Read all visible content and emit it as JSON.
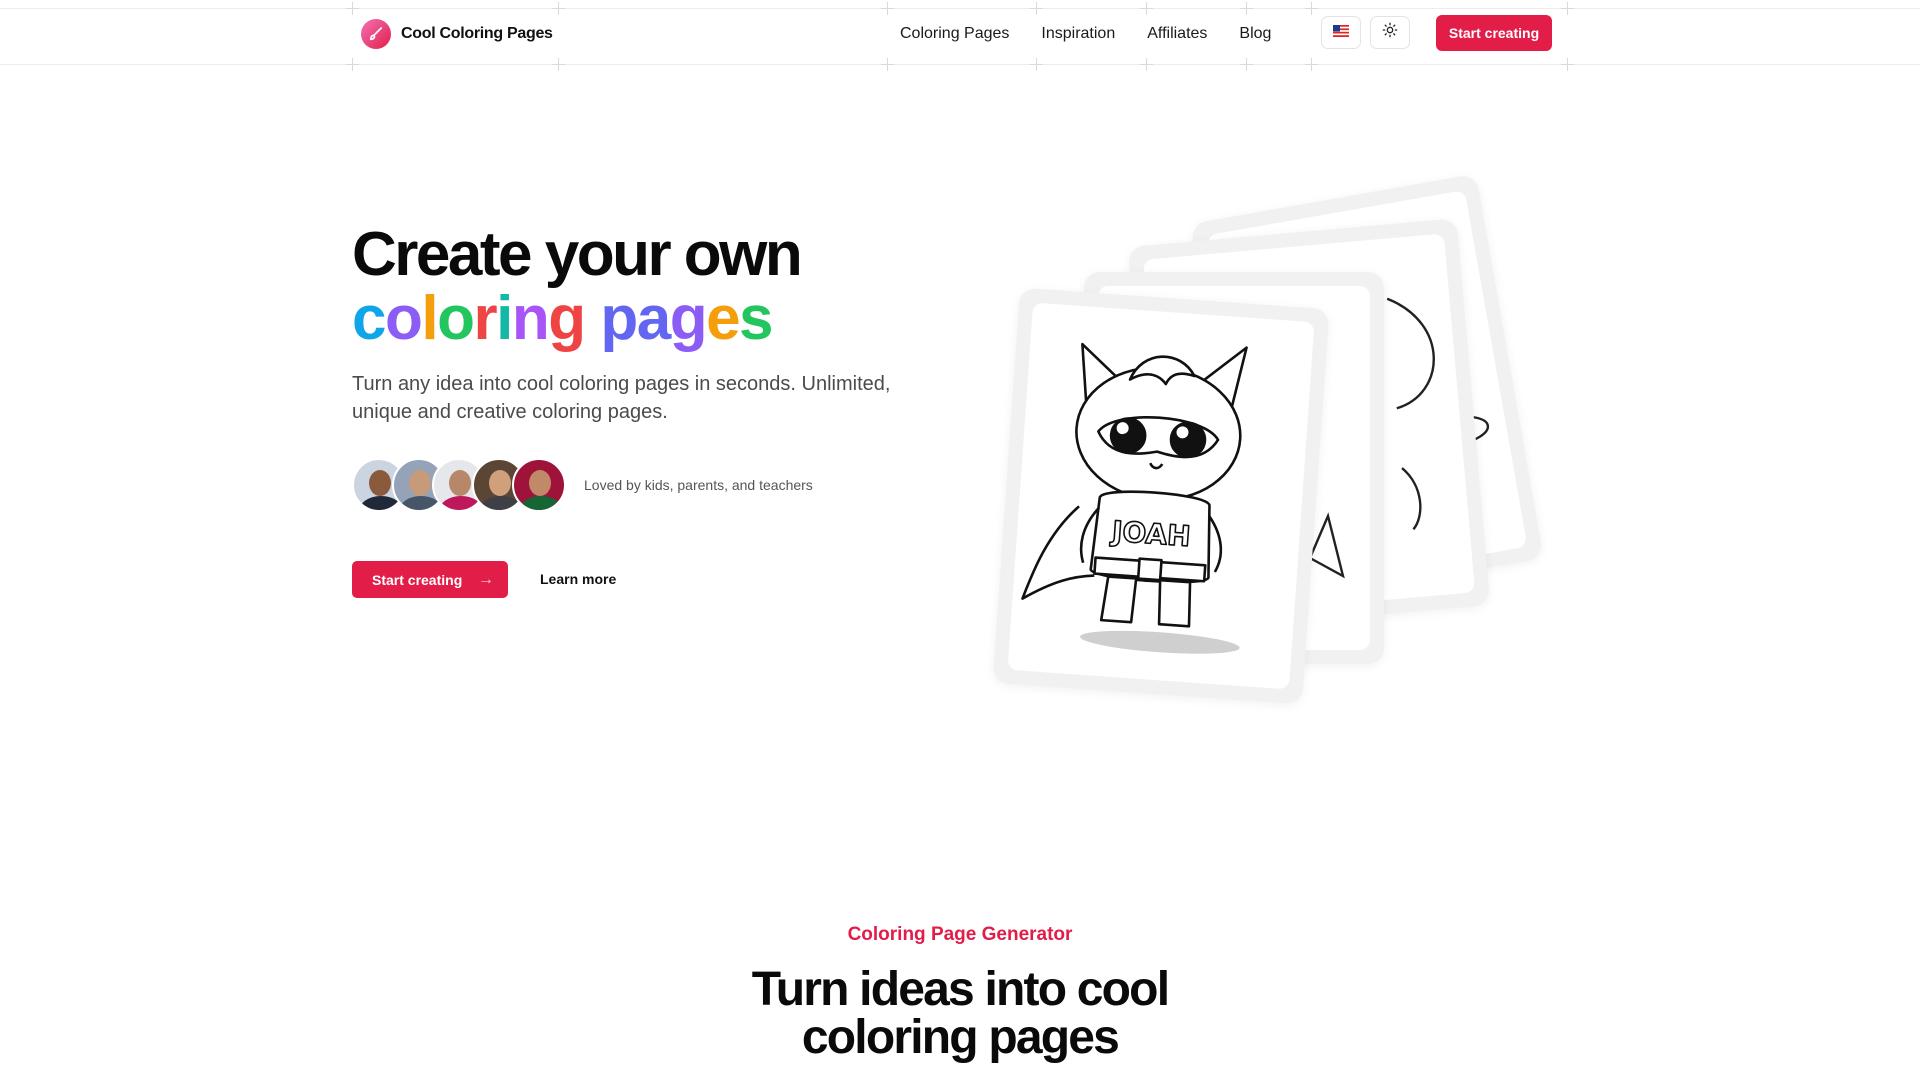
{
  "header": {
    "brand": "Cool Coloring Pages",
    "nav": [
      "Coloring Pages",
      "Inspiration",
      "Affiliates",
      "Blog"
    ],
    "language_icon": "us-flag-icon",
    "theme_icon": "sun-icon",
    "cta": "Start creating"
  },
  "hero": {
    "title_line1": "Create your own",
    "title_line2_letters": [
      "c",
      "o",
      "l",
      "o",
      "r",
      "i",
      "n",
      "g",
      " ",
      "p",
      "a",
      "g",
      "e",
      "s"
    ],
    "title_line2_colors": [
      "#0ea5e9",
      "#8b5cf6",
      "#f59e0b",
      "#22c55e",
      "#ef4444",
      "#14b8a6",
      "#a855f7",
      "#ef4444",
      "#000000",
      "#6366f1",
      "#6366f1",
      "#8b5cf6",
      "#f59e0b",
      "#22c55e"
    ],
    "subtitle": "Turn any idea into cool coloring pages in seconds. Unlimited, unique and creative coloring pages.",
    "social_proof": "Loved by kids, parents, and teachers",
    "cta_primary": "Start creating",
    "cta_secondary": "Learn more",
    "card_text": "JOAH"
  },
  "section": {
    "eyebrow": "Coloring Page Generator",
    "title_line1": "Turn ideas into cool",
    "title_line2": "coloring pages"
  },
  "colors": {
    "accent": "#e11d48",
    "text": "#0a0a0a",
    "muted": "#4b4b4b"
  }
}
